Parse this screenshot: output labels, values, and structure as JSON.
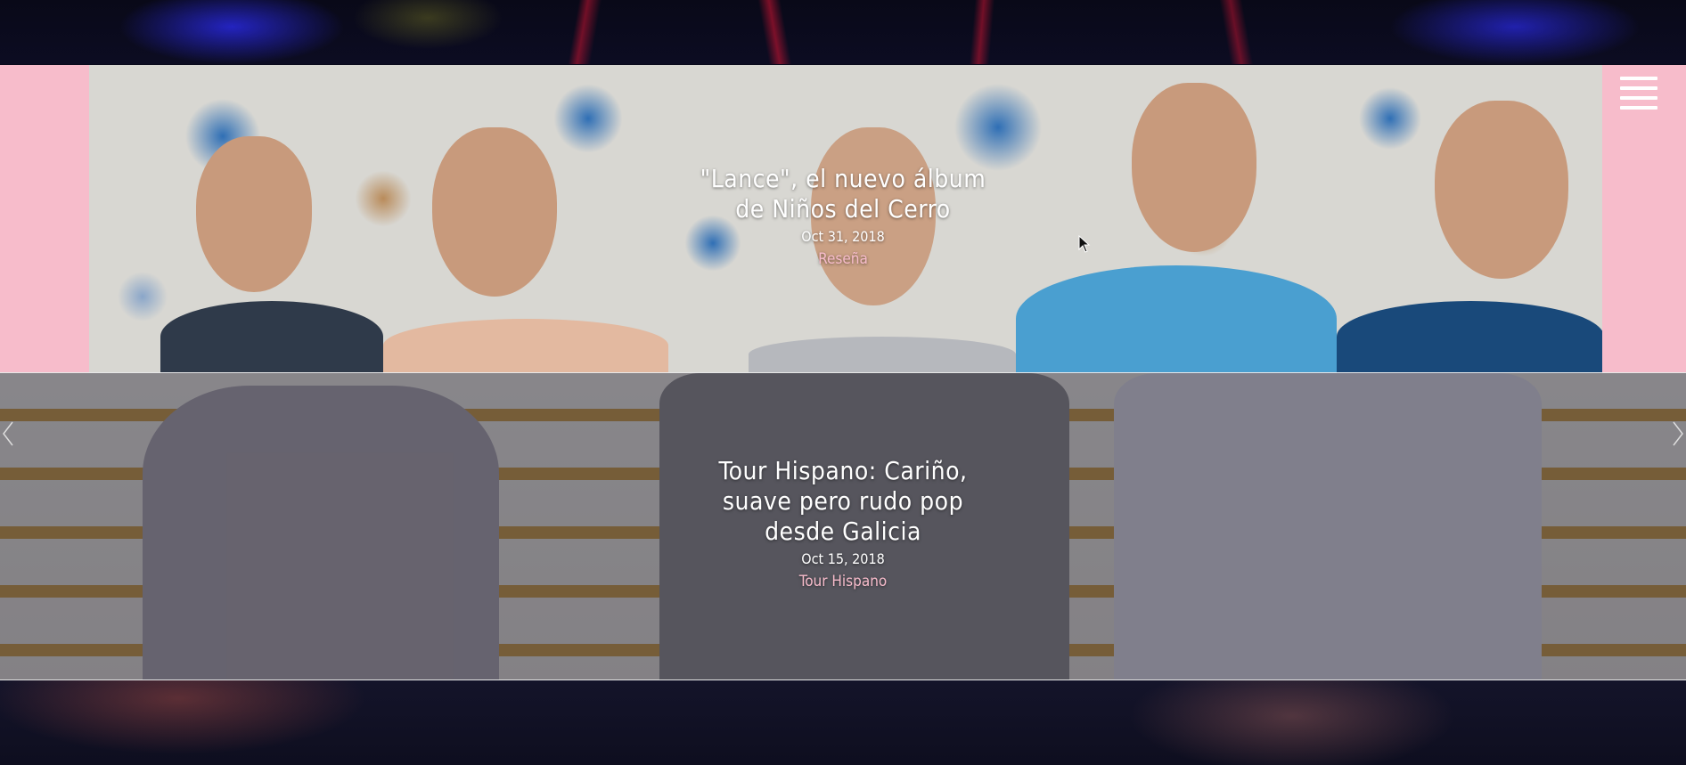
{
  "menu": {
    "icon": "hamburger-icon"
  },
  "slides": [
    {
      "title": "\"Lance\", el nuevo álbum de Niños del Cerro",
      "date": "Oct 31, 2018",
      "category": "Reseña"
    },
    {
      "title": "Tour Hispano: Cariño, suave pero rudo pop desde Galicia",
      "date": "Oct 15, 2018",
      "category": "Tour Hispano"
    }
  ],
  "navigation": {
    "prev_icon": "chevron-left-icon",
    "next_icon": "chevron-right-icon"
  },
  "colors": {
    "accent_pink": "#f7bccb",
    "text": "#ffffff"
  }
}
